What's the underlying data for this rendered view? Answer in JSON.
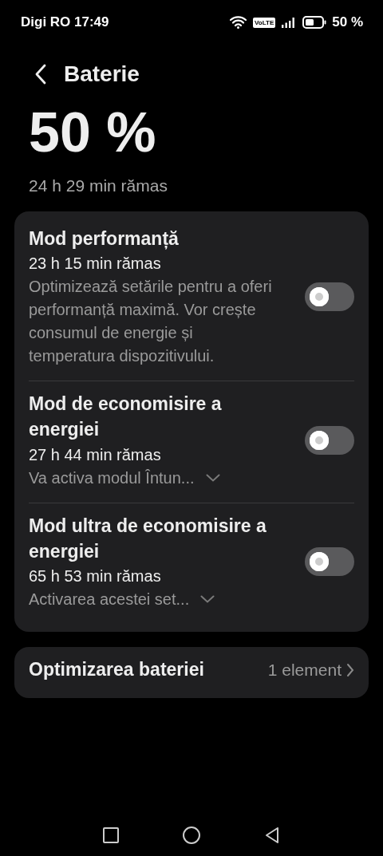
{
  "status_bar": {
    "carrier_time": "Digi RO 17:49",
    "volte": "VoLTE",
    "battery": "50 %"
  },
  "header": {
    "title": "Baterie"
  },
  "battery": {
    "percent": "50 %",
    "remaining": "24 h 29 min rămas"
  },
  "modes": [
    {
      "title": "Mod performanță",
      "remaining": "23 h 15 min rămas",
      "description": "Optimizează setările pentru a oferi performanță maximă. Vor crește consumul de energie și temperatura dispozitivului.",
      "kind": "full",
      "on": false
    },
    {
      "title": "Mod de economisire a energiei",
      "remaining": "27 h 44 min rămas",
      "description": "Va activa modul Întun...",
      "kind": "collapsed",
      "on": false
    },
    {
      "title": "Mod ultra de economisire a energiei",
      "remaining": "65 h 53 min rămas",
      "description": "Activarea acestei set...",
      "kind": "collapsed",
      "on": false
    }
  ],
  "optimization": {
    "title": "Optimizarea bateriei",
    "value": "1 element"
  }
}
